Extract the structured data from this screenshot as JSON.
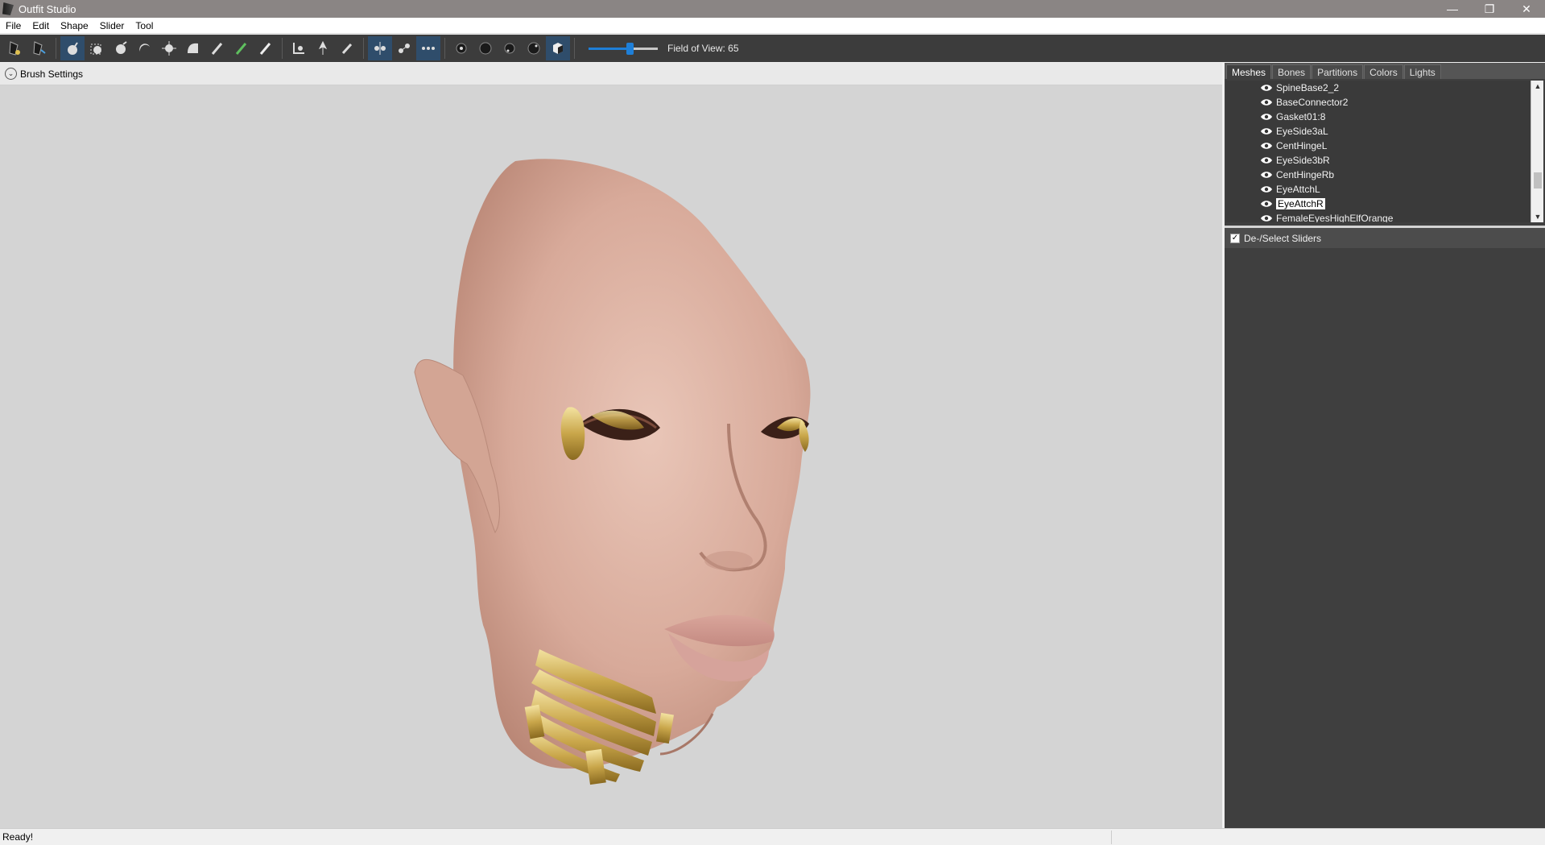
{
  "window": {
    "title": "Outfit Studio"
  },
  "menu": [
    "File",
    "Edit",
    "Shape",
    "Slider",
    "Tool"
  ],
  "toolbar": {
    "fov_label": "Field of View: 65",
    "fov_value": 65,
    "fov_min": 10,
    "fov_max": 100
  },
  "brush": {
    "label": "Brush Settings"
  },
  "panel": {
    "tabs": [
      "Meshes",
      "Bones",
      "Partitions",
      "Colors",
      "Lights"
    ],
    "active_tab": "Meshes",
    "meshes": [
      "SpineBase2_2",
      "BaseConnector2",
      "Gasket01:8",
      "EyeSide3aL",
      "CentHingeL",
      "EyeSide3bR",
      "CentHingeRb",
      "EyeAttchL",
      "EyeAttchR",
      "FemaleEyesHighElfOrange"
    ],
    "selected_mesh": "EyeAttchR",
    "sliders_label": "De-/Select Sliders",
    "sliders_checked": true
  },
  "status": {
    "text": "Ready!"
  },
  "colors": {
    "accent": "#1e7fd8",
    "toolbar": "#3c3c3c",
    "panel": "#3f3f3f",
    "viewport": "#d4d4d4"
  }
}
